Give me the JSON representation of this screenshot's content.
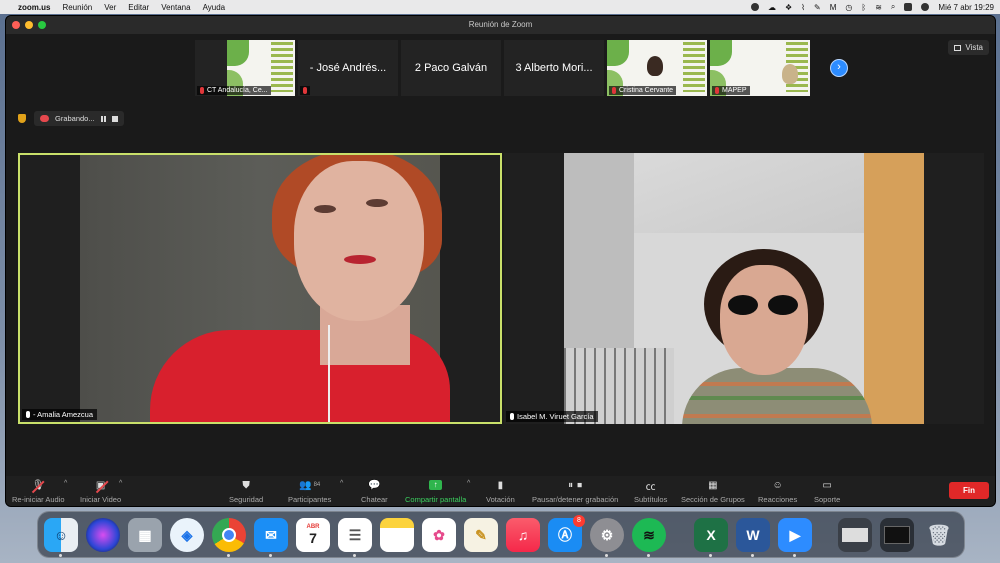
{
  "menubar": {
    "app": "zoom.us",
    "menus": [
      "Reunión",
      "Ver",
      "Editar",
      "Ventana",
      "Ayuda"
    ],
    "clock": "Mié 7 abr  19:29"
  },
  "window": {
    "title": "Reunión de Zoom"
  },
  "strip": {
    "thumbs": [
      {
        "label": "CT Andalucía, Ce..."
      },
      {
        "name": "- José Andrés..."
      },
      {
        "name": "2 Paco Galván"
      },
      {
        "name": "3 Alberto Mori..."
      },
      {
        "label": "Cristina Cervante"
      },
      {
        "label": "MAPEP"
      }
    ],
    "view_label": "Vista"
  },
  "recording": {
    "label": "Grabando..."
  },
  "tiles": {
    "left": {
      "name": "- Amalia Amezcua"
    },
    "right": {
      "name": "Isabel M. Viruet García"
    }
  },
  "toolbar": {
    "audio": "Re-iniciar Audio",
    "video": "Iniciar Video",
    "security": "Seguridad",
    "participants": "Participantes",
    "participants_count": "84",
    "chat": "Chatear",
    "share": "Compartir pantalla",
    "poll": "Votación",
    "record": "Pausar/detener grabación",
    "subtitles": "Subtítulos",
    "breakout": "Sección de Grupos",
    "reactions": "Reacciones",
    "support": "Soporte",
    "end": "Fin"
  },
  "dock": {
    "calendar_month": "ABR",
    "calendar_day": "7",
    "appstore_badge": "8"
  },
  "colors": {
    "active_speaker_border": "#c9e06a",
    "share_green": "#2fb54d",
    "end_red": "#e02828",
    "zoom_blue": "#2d8cff"
  }
}
